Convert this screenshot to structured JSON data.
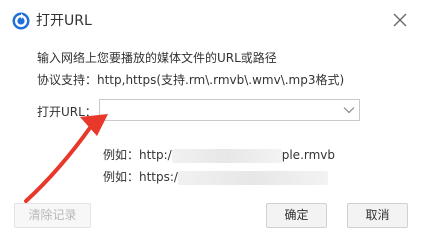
{
  "window": {
    "title": "打开URL",
    "close_icon": "close-icon",
    "app_icon": "player-logo-icon",
    "accent": "#1e6fd9"
  },
  "instructions": {
    "line1": "输入网络上您要播放的媒体文件的URL或路径",
    "line2": "协议支持：http,https(支持.rm\\.rmvb\\.wmv\\.mp3格式)"
  },
  "url": {
    "label": "打开URL：",
    "value": "",
    "dropdown_icon": "chevron-down-icon"
  },
  "examples": {
    "ex1_prefix": "例如：http:/",
    "ex1_suffix": "ple.rmvb",
    "ex2_prefix": "例如：https:/"
  },
  "annotation": {
    "arrow_color": "#e8372b"
  },
  "buttons": {
    "clear": "清除记录",
    "ok": "确定",
    "cancel": "取消"
  }
}
